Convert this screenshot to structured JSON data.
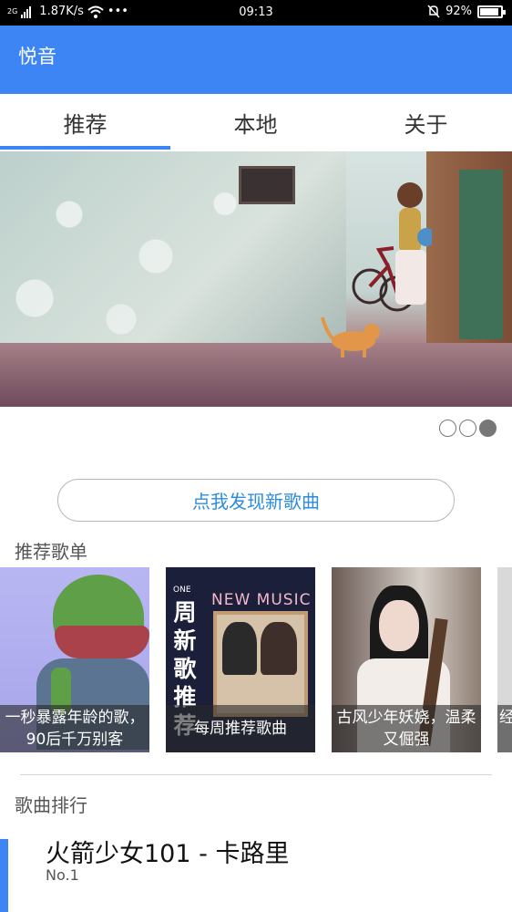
{
  "status_bar": {
    "network": "2G",
    "speed": "1.87K/s",
    "more": "•••",
    "time": "09:13",
    "battery": "92%",
    "battery_level": 0.92,
    "icons": [
      "signal-icon",
      "wifi-icon",
      "mute-bell-icon",
      "battery-icon"
    ]
  },
  "app_bar": {
    "title": "悦音",
    "color": "#3d85f4"
  },
  "tabs": [
    {
      "label": "推荐",
      "selected": true
    },
    {
      "label": "本地",
      "selected": false
    },
    {
      "label": "关于",
      "selected": false
    }
  ],
  "banner": {
    "page_count": 3,
    "active_page": 3
  },
  "discover_button": {
    "label": "点我发现新歌曲",
    "color": "#2d8cdb"
  },
  "playlists_section": {
    "title": "推荐歌单",
    "items": [
      {
        "caption": "一秒暴露年龄的歌，90后千万别客"
      },
      {
        "caption": "每周推荐歌曲",
        "cover_text": "周新歌推荐",
        "cover_small": "ONE",
        "cover_en": "NEW MUSIC"
      },
      {
        "caption": "古风少年妖娆，温柔又倔强"
      },
      {
        "caption": "经"
      }
    ]
  },
  "ranking_section": {
    "title": "歌曲排行",
    "items": [
      {
        "title": "火箭少女101 - 卡路里",
        "rank": "No.1"
      }
    ]
  }
}
